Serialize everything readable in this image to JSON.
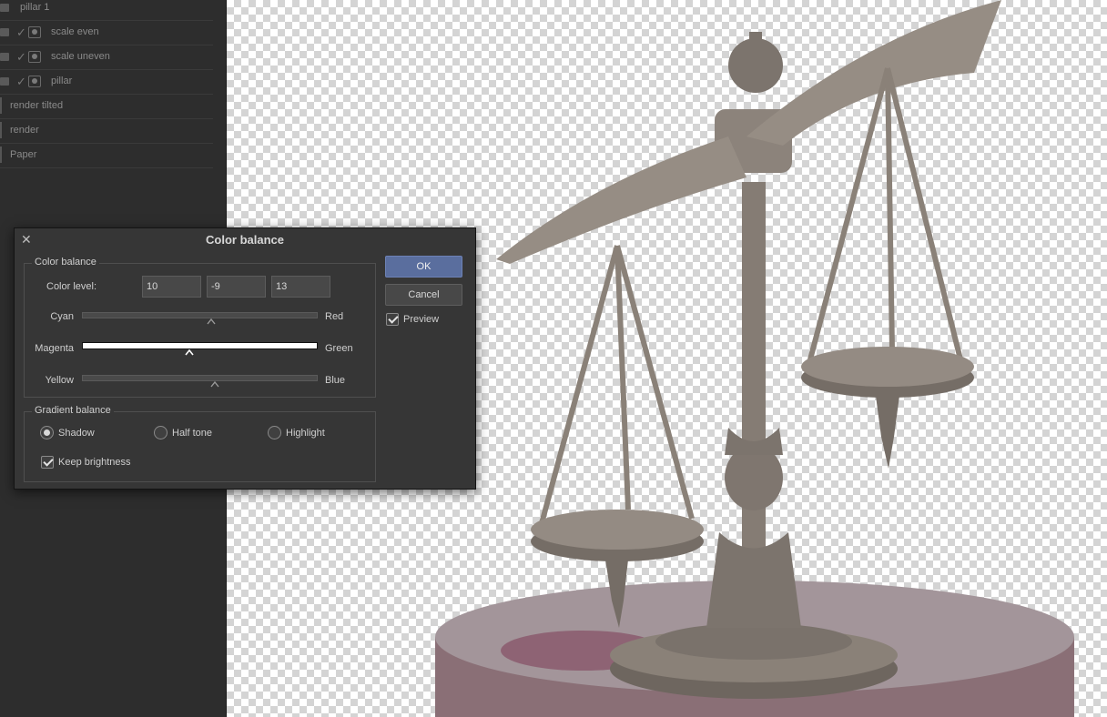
{
  "layers": [
    {
      "name": "pillar 1",
      "kind": "folder"
    },
    {
      "name": "scale even",
      "kind": "folder",
      "visible": true
    },
    {
      "name": "scale uneven",
      "kind": "folder",
      "visible": true
    },
    {
      "name": "pillar",
      "kind": "folder",
      "visible": true
    },
    {
      "name": "render tilted",
      "kind": "layer"
    },
    {
      "name": "render",
      "kind": "layer"
    },
    {
      "name": "Paper",
      "kind": "layer"
    }
  ],
  "dialog": {
    "title": "Color balance",
    "close_icon": "close-icon",
    "color_balance": {
      "group_label": "Color balance",
      "color_level_label": "Color level:",
      "levels": [
        "10",
        "-9",
        "13"
      ],
      "sliders": [
        {
          "left": "Cyan",
          "right": "Red",
          "value": 10
        },
        {
          "left": "Magenta",
          "right": "Green",
          "value": -9
        },
        {
          "left": "Yellow",
          "right": "Blue",
          "value": 13
        }
      ]
    },
    "gradient_balance": {
      "group_label": "Gradient balance",
      "options": [
        "Shadow",
        "Half tone",
        "Highlight"
      ],
      "selected": "Shadow",
      "keep_brightness_label": "Keep brightness",
      "keep_brightness": true
    },
    "ok_label": "OK",
    "cancel_label": "Cancel",
    "preview_label": "Preview",
    "preview": true
  },
  "colors": {
    "panel_bg": "#2d2d2d",
    "dialog_bg": "#363636",
    "ok_accent": "#5a6e9e",
    "scale_metal": "#8a8178",
    "base_tint": "#8a6f76"
  }
}
